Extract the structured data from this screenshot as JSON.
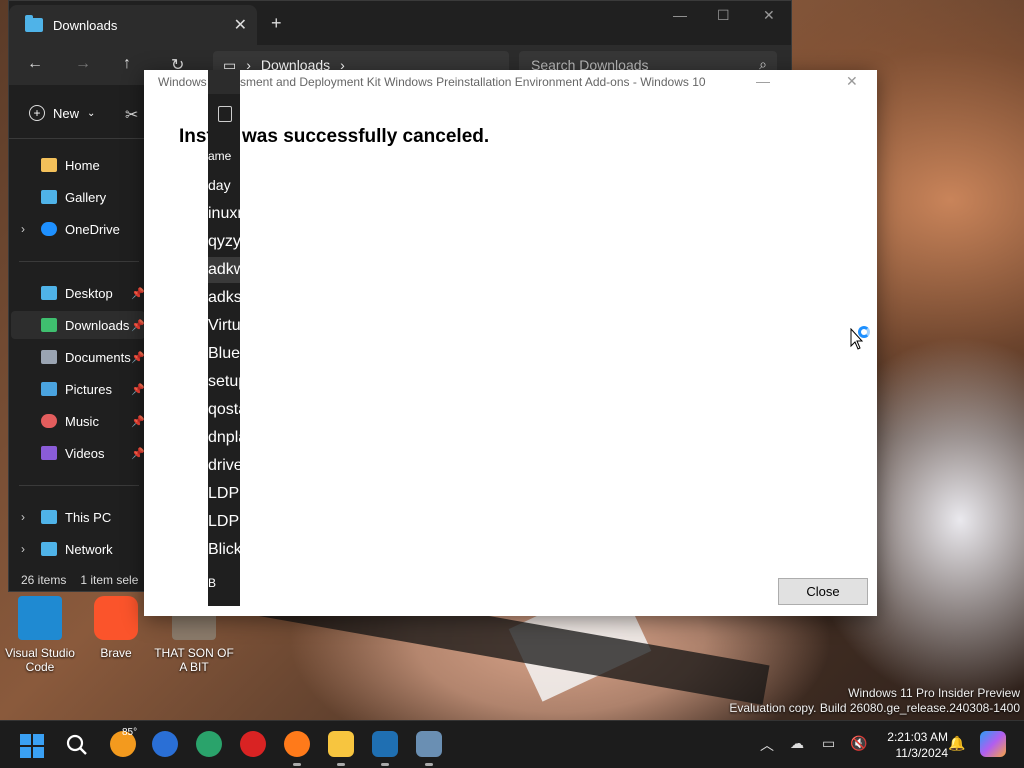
{
  "explorer": {
    "tab_title": "Downloads",
    "breadcrumb_current": "Downloads",
    "search_placeholder": "Search Downloads",
    "new_label": "New",
    "sidebar": [
      {
        "label": "Home",
        "color": "#f3c05a"
      },
      {
        "label": "Gallery",
        "color": "#4fb3e8"
      },
      {
        "label": "OneDrive",
        "color": "#1e90ff"
      },
      {
        "label": "Desktop",
        "color": "#4fb3e8"
      },
      {
        "label": "Downloads",
        "color": "#3fbf6f"
      },
      {
        "label": "Documents",
        "color": "#9aa4b2"
      },
      {
        "label": "Pictures",
        "color": "#4aa3df"
      },
      {
        "label": "Music",
        "color": "#e35d5d"
      },
      {
        "label": "Videos",
        "color": "#8a5cd8"
      },
      {
        "label": "This PC",
        "color": "#4fb3e8"
      },
      {
        "label": "Network",
        "color": "#4fb3e8"
      }
    ],
    "file_fragments": [
      "ame",
      "day",
      "inuxm",
      "qyzylja",
      "adkwin",
      "adkset",
      "Virtual",
      "Blue Sl",
      "setup",
      "qostan",
      "dnplay",
      "driver_",
      "LDPlay",
      "LDPlay",
      "Blickln"
    ],
    "status_items": "26 items",
    "status_selected": "1 item sele",
    "status_size": "B"
  },
  "installer": {
    "title": "Windows Assessment and Deployment Kit Windows Preinstallation Environment Add-ons - Windows 10",
    "title_visible_left": "Windows",
    "title_visible_right": "sment and Deployment Kit Windows Preinstallation Environment Add-ons - Windows 10",
    "message_left": "Inst",
    "message_right": "was successfully canceled.",
    "close_label": "Close"
  },
  "desktop": {
    "icons": [
      {
        "label": "Visual Studio Code",
        "color": "#1f8ad2"
      },
      {
        "label": "Brave",
        "color": "#fb542b"
      },
      {
        "label": "THAT SON OF A BIT",
        "color": "#8a7a6a"
      }
    ],
    "watermark_line1": "Windows 11 Pro Insider Preview",
    "watermark_line2": "Evaluation copy. Build 26080.ge_release.240308-1400"
  },
  "taskbar": {
    "weather_temp": "85°",
    "time": "2:21:03 AM",
    "date": "11/3/2024"
  }
}
